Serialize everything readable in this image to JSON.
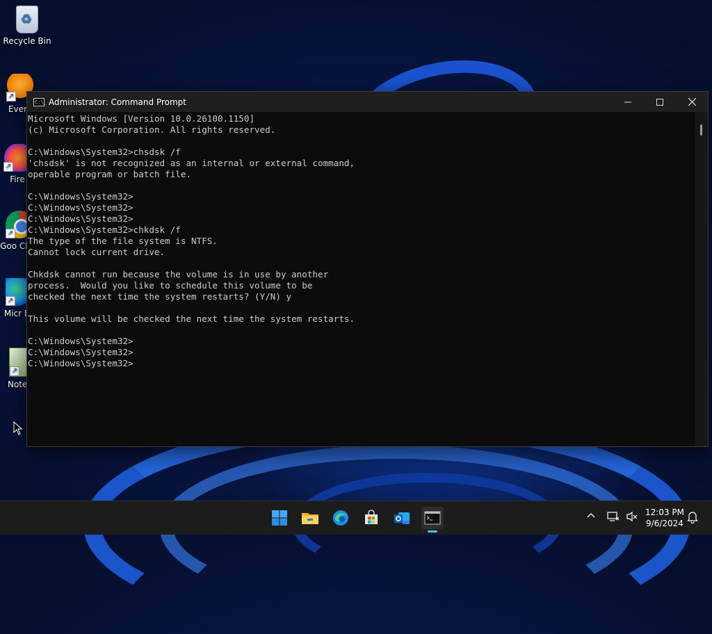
{
  "desktop": {
    "icons": [
      {
        "label": "Recycle Bin",
        "icon": "recycle-bin-icon"
      },
      {
        "label": "Every",
        "icon": "everything-icon"
      },
      {
        "label": "Fire",
        "icon": "firefox-icon"
      },
      {
        "label": "Goo Chro",
        "icon": "chrome-icon"
      },
      {
        "label": "Micr Ed",
        "icon": "edge-icon"
      },
      {
        "label": "Notep",
        "icon": "notepad-icon"
      }
    ]
  },
  "window": {
    "title": "Administrator: Command Prompt",
    "icon": "cmd-icon",
    "controls": {
      "minimize": "minimize-icon",
      "maximize": "maximize-icon",
      "close": "close-icon"
    }
  },
  "console": {
    "lines": [
      "Microsoft Windows [Version 10.0.26100.1150]",
      "(c) Microsoft Corporation. All rights reserved.",
      "",
      "C:\\Windows\\System32>chsdsk /f",
      "'chsdsk' is not recognized as an internal or external command,",
      "operable program or batch file.",
      "",
      "C:\\Windows\\System32>",
      "C:\\Windows\\System32>",
      "C:\\Windows\\System32>",
      "C:\\Windows\\System32>chkdsk /f",
      "The type of the file system is NTFS.",
      "Cannot lock current drive.",
      "",
      "Chkdsk cannot run because the volume is in use by another",
      "process.  Would you like to schedule this volume to be",
      "checked the next time the system restarts? (Y/N) y",
      "",
      "This volume will be checked the next time the system restarts.",
      "",
      "C:\\Windows\\System32>",
      "C:\\Windows\\System32>",
      "C:\\Windows\\System32>"
    ]
  },
  "taskbar": {
    "apps": [
      {
        "name": "start",
        "icon": "windows-start-icon"
      },
      {
        "name": "file-explorer",
        "icon": "folder-icon"
      },
      {
        "name": "edge",
        "icon": "edge-icon"
      },
      {
        "name": "store",
        "icon": "store-icon"
      },
      {
        "name": "outlook",
        "icon": "outlook-icon"
      },
      {
        "name": "terminal",
        "icon": "terminal-icon",
        "active": true
      }
    ],
    "tray": {
      "time": "12:03 PM",
      "date": "9/6/2024"
    }
  },
  "colors": {
    "console_bg": "#0c0c0c",
    "console_text": "#cccccc",
    "titlebar_bg": "#1f1f1f",
    "taskbar_bg": "#1c1c1c",
    "accent": "#4cc2ff"
  }
}
